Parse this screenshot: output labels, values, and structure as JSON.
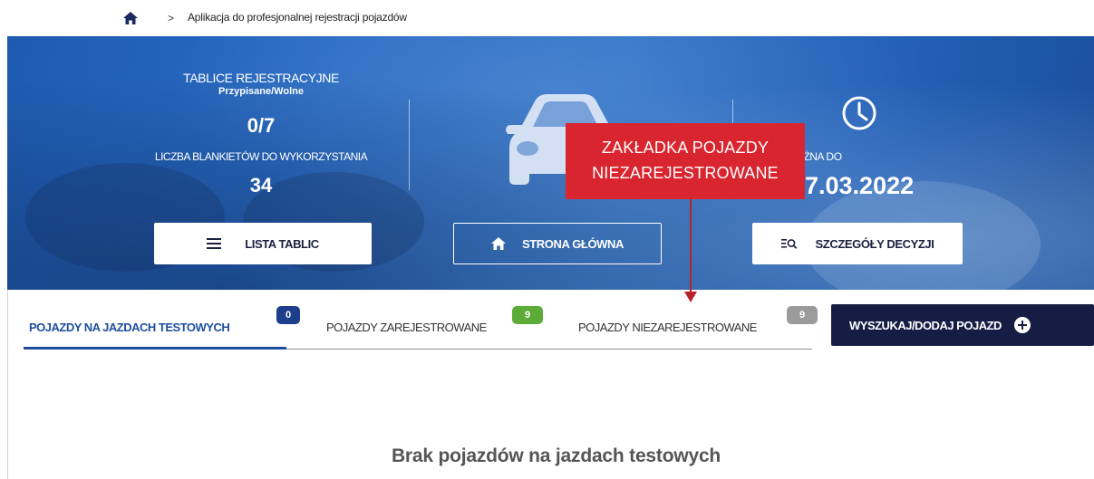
{
  "breadcrumb": {
    "separator": ">",
    "current": "Aplikacja do profesjonalnej rejestracji pojazdów"
  },
  "banner": {
    "plates_title": "TABLICE REJESTRACYJNE",
    "plates_subtitle": "Przypisane/Wolne",
    "plates_value": "0/7",
    "blanks_label": "LICZBA BLANKIETÓW DO WYKORZYSTANIA",
    "blanks_value": "34",
    "decision_label": "CYZJA WAŻNA DO",
    "decision_date": "7.03.2022"
  },
  "buttons": {
    "plates_list": "LISTA TABLIC",
    "home": "STRONA GŁÓWNA",
    "decision_details": "SZCZEGÓŁY DECYZJI"
  },
  "callout": {
    "line1": "ZAKŁADKA POJAZDY",
    "line2": "NIEZAREJESTROWANE"
  },
  "tabs": [
    {
      "label": "POJAZDY NA JAZDACH TESTOWYCH",
      "count": "0",
      "badge_color": "#1d3f8c",
      "active": true
    },
    {
      "label": "POJAZDY ZAREJESTROWANE",
      "count": "9",
      "badge_color": "#5cab37",
      "active": false
    },
    {
      "label": "POJAZDY NIEZAREJESTROWANE",
      "count": "9",
      "badge_color": "#9b9b9b",
      "active": false
    }
  ],
  "search_button": "WYSZUKAJ/DODAJ POJAZD",
  "empty_message": "Brak pojazdów na jazdach testowych",
  "icons": {
    "breadcrumb_home": "home-icon",
    "car": "car-icon",
    "clock": "clock-icon",
    "list": "menu-icon",
    "home": "home-icon",
    "search_list": "list-search-icon",
    "plus": "plus-circle-icon"
  },
  "colors": {
    "accent_blue": "#1d4e9e",
    "dark_navy": "#151d45",
    "callout_red": "#d9252f"
  }
}
